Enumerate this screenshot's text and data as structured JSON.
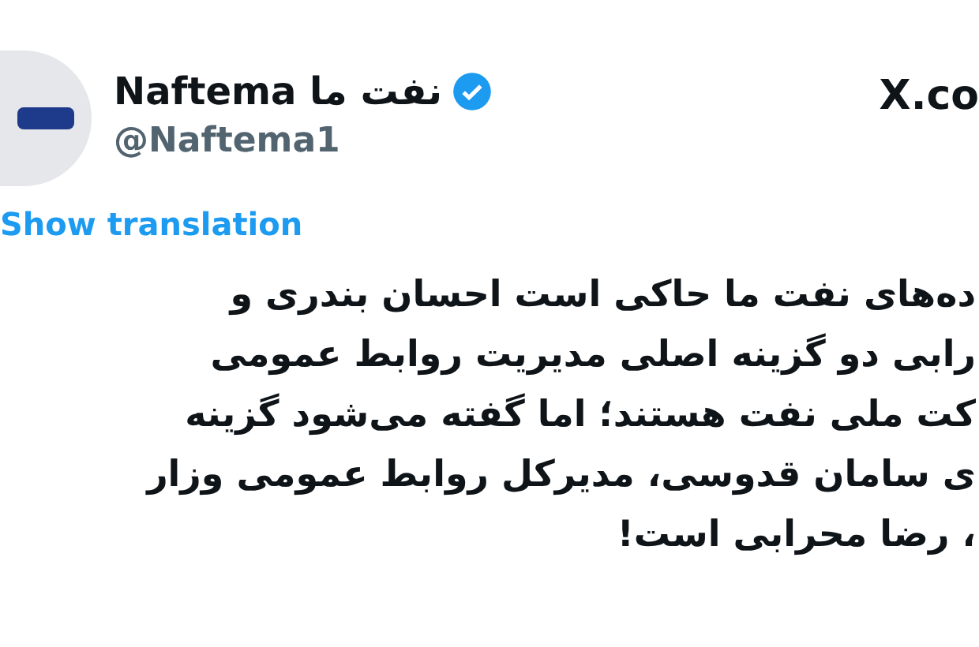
{
  "author": {
    "name": "Naftema نفت ما",
    "verified": true,
    "handle": "@Naftema1"
  },
  "site": "X.co",
  "translate_link": "Show translation",
  "tweet_lines": [
    "ده‌های نفت ما حاکی است احسان بندری و",
    "رابی دو گزینه اصلی مدیریت روابط عمومی",
    "کت ملی نفت هستند؛ اما گفته می‌شود گزینه",
    "ی سامان قدوسی، مدیرکل روابط عمومی وزار",
    "، رضا محرابی است!"
  ]
}
